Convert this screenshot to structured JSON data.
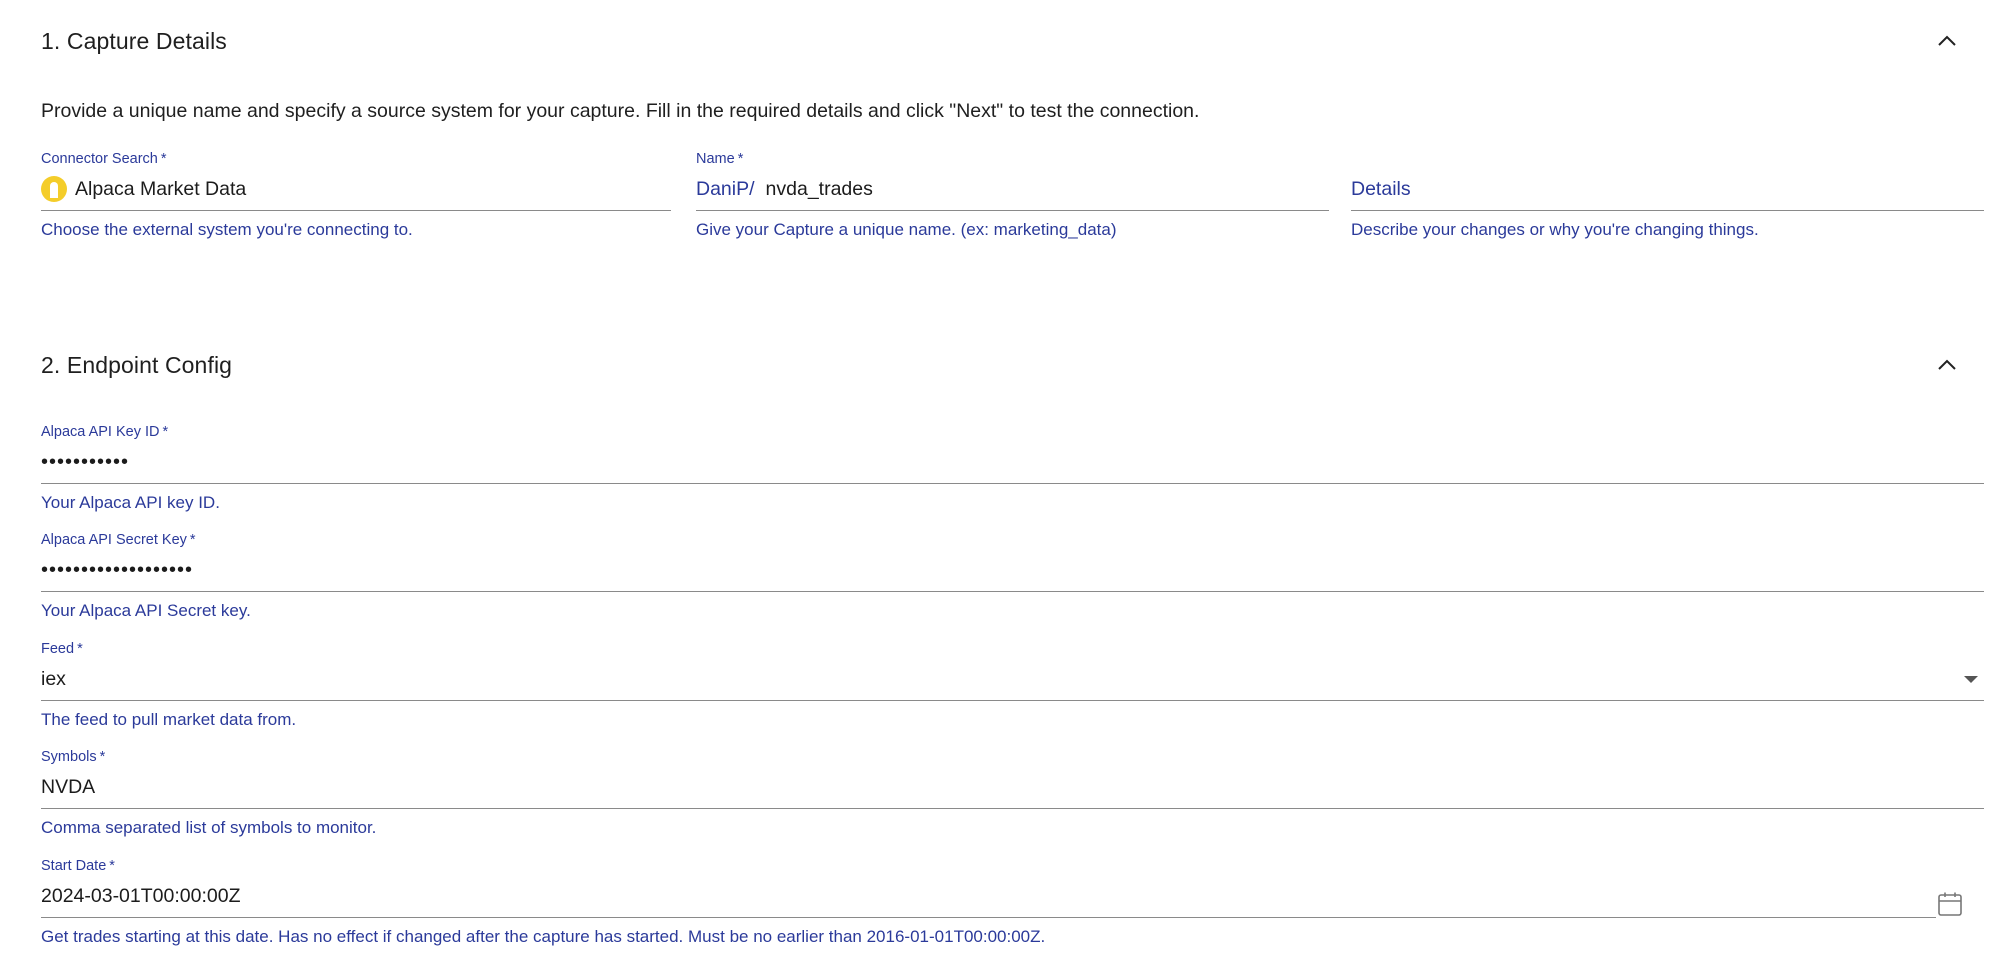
{
  "section1": {
    "title": "1. Capture Details",
    "intro": "Provide a unique name and specify a source system for your capture. Fill in the required details and click \"Next\" to test the connection.",
    "connector": {
      "label": "Connector Search",
      "required": "*",
      "value": "Alpaca Market Data",
      "helper": "Choose the external system you're connecting to.",
      "icon": "alpaca-logo-icon"
    },
    "name": {
      "label": "Name",
      "required": "*",
      "prefix": "DaniP/",
      "value": "nvda_trades",
      "helper": "Give your Capture a unique name. (ex: marketing_data)"
    },
    "details": {
      "placeholder": "Details",
      "helper": "Describe your changes or why you're changing things."
    }
  },
  "section2": {
    "title": "2. Endpoint Config",
    "api_key_id": {
      "label": "Alpaca API Key ID",
      "required": "*",
      "value": "•••••••••••",
      "helper": "Your Alpaca API key ID."
    },
    "api_secret": {
      "label": "Alpaca API Secret Key",
      "required": "*",
      "value": "•••••••••••••••••••",
      "helper": "Your Alpaca API Secret key."
    },
    "feed": {
      "label": "Feed",
      "required": "*",
      "value": "iex",
      "helper": "The feed to pull market data from."
    },
    "symbols": {
      "label": "Symbols",
      "required": "*",
      "value": "NVDA",
      "helper": "Comma separated list of symbols to monitor."
    },
    "start_date": {
      "label": "Start Date",
      "required": "*",
      "value": "2024-03-01T00:00:00Z",
      "helper": "Get trades starting at this date. Has no effect if changed after the capture has started. Must be no earlier than 2016-01-01T00:00:00Z."
    }
  },
  "colors": {
    "accent": "#2b3a9a",
    "underline": "#8a8a8a",
    "logo": "#f4cd2a"
  }
}
